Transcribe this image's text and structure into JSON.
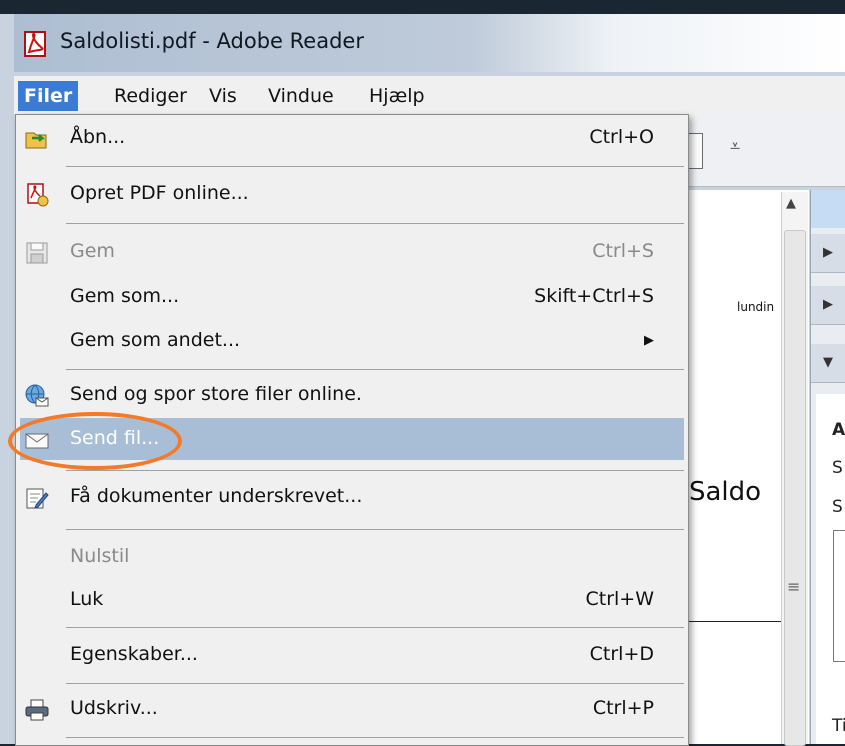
{
  "window": {
    "title": "Saldolisti.pdf - Adobe Reader"
  },
  "menubar": [
    "Filer",
    "Rediger",
    "Vis",
    "Vindue",
    "Hjælp"
  ],
  "menu": {
    "items": [
      {
        "label": "Åbn...",
        "shortcut": "Ctrl+O",
        "icon": "open-folder-icon",
        "state": "enabled"
      },
      {
        "label": "Opret PDF online...",
        "shortcut": "",
        "icon": "create-pdf-icon",
        "state": "enabled"
      },
      {
        "label": "Gem",
        "shortcut": "Ctrl+S",
        "icon": "save-disk-icon",
        "state": "disabled"
      },
      {
        "label": "Gem som...",
        "shortcut": "Skift+Ctrl+S",
        "state": "enabled"
      },
      {
        "label": "Gem som andet...",
        "shortcut": "",
        "submenu": true,
        "state": "enabled"
      },
      {
        "label": "Send og spor store filer online.",
        "shortcut": "",
        "icon": "globe-envelope-icon",
        "state": "enabled"
      },
      {
        "label": "Send fil...",
        "shortcut": "",
        "icon": "envelope-icon",
        "state": "highlighted"
      },
      {
        "label": "Få dokumenter underskrevet...",
        "shortcut": "",
        "icon": "sign-document-icon",
        "state": "enabled"
      },
      {
        "label": "Nulstil",
        "shortcut": "",
        "state": "disabled"
      },
      {
        "label": "Luk",
        "shortcut": "Ctrl+W",
        "state": "enabled"
      },
      {
        "label": "Egenskaber...",
        "shortcut": "Ctrl+D",
        "state": "enabled"
      },
      {
        "label": "Udskriv...",
        "shortcut": "Ctrl+P",
        "icon": "printer-icon",
        "state": "enabled"
      }
    ]
  },
  "document": {
    "small_text": "lundin",
    "title_text": "Saldo"
  },
  "right_panel": {
    "letters": [
      "A",
      "S",
      "S",
      "Ti"
    ]
  },
  "colors": {
    "highlight": "#a7bed6",
    "annotation_circle": "#f27a2a",
    "menu_active": "#3a7bd5"
  }
}
